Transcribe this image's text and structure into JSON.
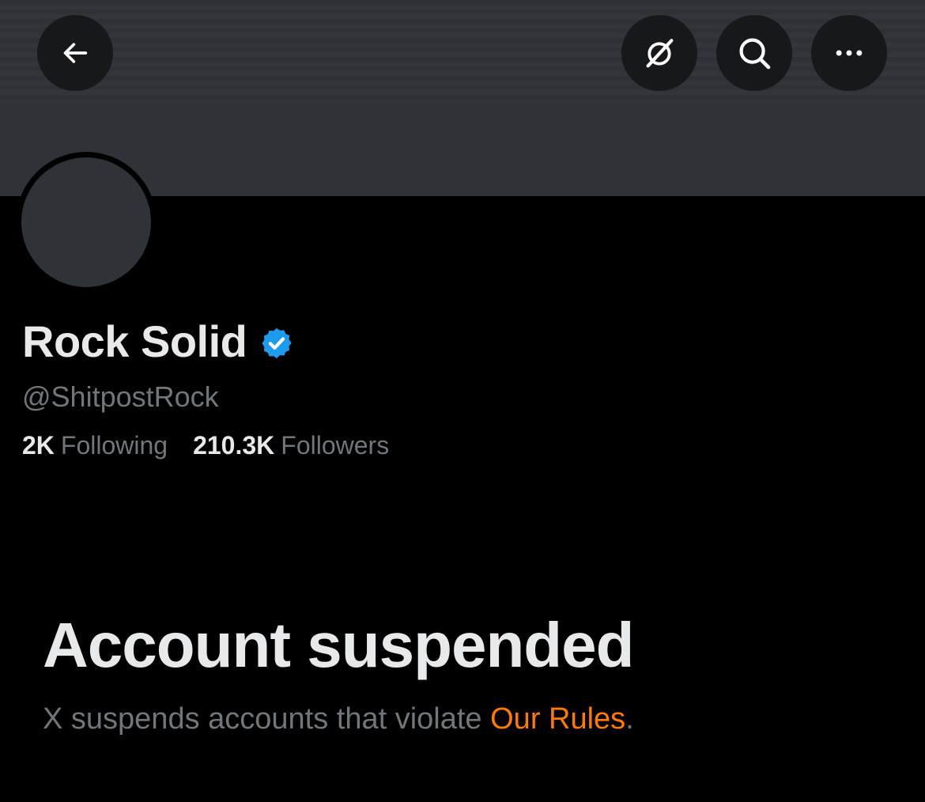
{
  "header": {
    "back_icon": "arrow-left-icon",
    "grok_icon": "grok-icon",
    "search_icon": "search-icon",
    "more_icon": "more-horizontal-icon"
  },
  "profile": {
    "display_name": "Rock Solid",
    "verified": true,
    "verified_badge_color": "#1d9bf0",
    "handle": "@ShitpostRock",
    "following_count": "2K",
    "following_label": "Following",
    "followers_count": "210.3K",
    "followers_label": "Followers"
  },
  "suspension": {
    "title": "Account suspended",
    "message_prefix": "X suspends accounts that violate ",
    "rules_link": "Our Rules",
    "message_suffix": ".",
    "link_color": "#ff7a00"
  },
  "colors": {
    "background": "#000000",
    "banner": "#2f3236",
    "primary_text": "#e7e9ea",
    "secondary_text": "#71767b"
  }
}
